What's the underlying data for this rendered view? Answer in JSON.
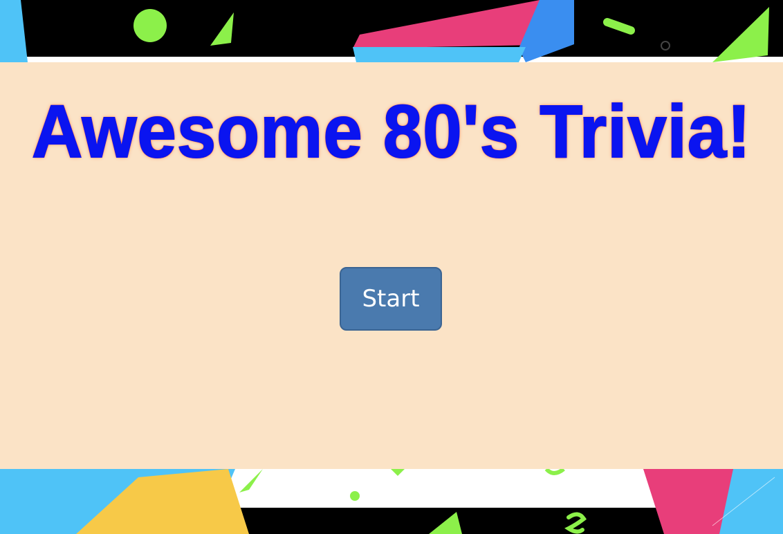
{
  "game": {
    "title": "Awesome 80's Trivia!",
    "start_label": "Start"
  },
  "theme": {
    "panel_background": "#fbe3c6",
    "title_color": "#0a14f0",
    "title_glow": "#ff7a4a",
    "button_background": "#4a7aae",
    "button_text": "#ffffff"
  },
  "background": {
    "style": "memphis-80s-pattern",
    "colors": [
      "#000000",
      "#ffffff",
      "#e83e7a",
      "#4fc3f7",
      "#8cf04a",
      "#f7c948",
      "#3a8ef0"
    ]
  }
}
